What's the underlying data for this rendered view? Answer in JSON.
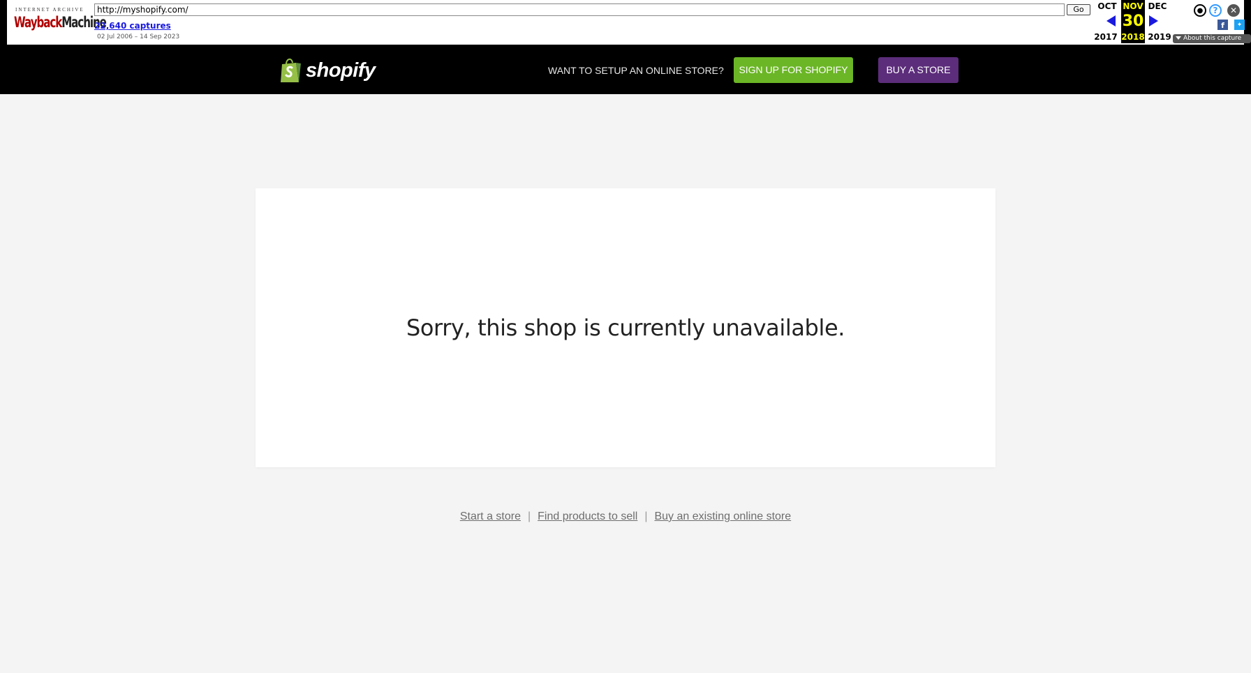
{
  "wayback": {
    "logo_top": "INTERNET ARCHIVE",
    "logo_part1": "Wayback",
    "logo_part2": "Machine",
    "url": "http://myshopify.com/",
    "go_label": "Go",
    "captures": "22,640 captures",
    "date_range": "02 Jul 2006 – 14 Sep 2023",
    "prev_month": "OCT",
    "cur_month": "NOV",
    "next_month": "DEC",
    "cur_day": "30",
    "prev_year": "2017",
    "cur_year": "2018",
    "next_year": "2019",
    "about_label": "About this capture",
    "highlight_color": "#ffff00",
    "link_color": "#1a1adf"
  },
  "header": {
    "logo_text": "shopify",
    "cta_text": "WANT TO SETUP AN ONLINE STORE?",
    "signup_label": "SIGN UP FOR SHOPIFY",
    "buy_label": "BUY A STORE",
    "signup_color": "#6bb626",
    "buy_color": "#5c2d7b"
  },
  "main": {
    "message": "Sorry, this shop is currently unavailable."
  },
  "footer": {
    "links": [
      "Start a store",
      "Find products to sell",
      "Buy an existing online store"
    ],
    "separator": "|"
  },
  "icons": {
    "user": "user-icon",
    "help": "help-icon",
    "close": "close-icon",
    "facebook": "facebook-icon",
    "twitter": "twitter-icon",
    "shopify_bag": "shopify-bag-icon"
  }
}
